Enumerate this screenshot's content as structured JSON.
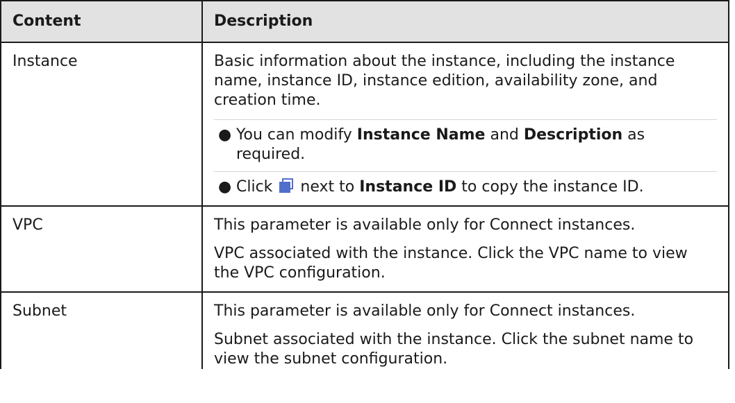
{
  "table": {
    "header": {
      "content": "Content",
      "description": "Description"
    },
    "rows": [
      {
        "name": "Instance",
        "intro": "Basic information about the instance, including the instance name, instance ID, instance edition, availability zone, and creation time.",
        "bullet1": {
          "pre": "You can modify ",
          "bold1": "Instance Name",
          "mid": " and ",
          "bold2": "Description",
          "post": " as required."
        },
        "bullet2": {
          "pre": "Click ",
          "icon": "copy-icon",
          "mid": " next to ",
          "bold": "Instance ID",
          "post": " to copy the instance ID."
        }
      },
      {
        "name": "VPC",
        "p1": "This parameter is available only for Connect instances.",
        "p2": "VPC associated with the instance. Click the VPC name to view the VPC configuration."
      },
      {
        "name": "Subnet",
        "p1": "This parameter is available only for Connect instances.",
        "p2": "Subnet associated with the instance. Click the subnet name to view the subnet configuration."
      }
    ]
  },
  "colors": {
    "header_bg": "#e2e2e2",
    "border": "#1a1a1a",
    "icon_accent": "#526ecc"
  }
}
